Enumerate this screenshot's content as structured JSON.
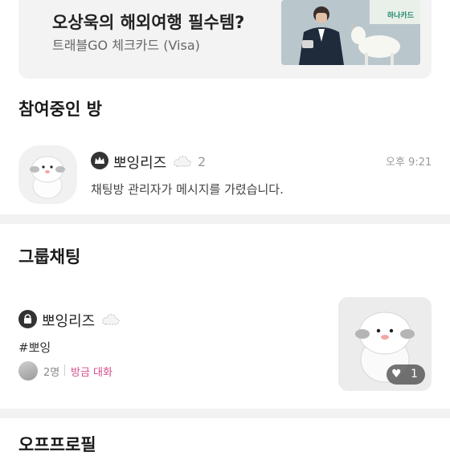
{
  "ad": {
    "title": "오상욱의 해외여행 필수템?",
    "subtitle": "트래블GO 체크카드 (Visa)",
    "brand": "하나카드"
  },
  "joined": {
    "title": "참여중인 방",
    "room": {
      "name": "뽀잉리즈",
      "count": "2",
      "time": "오후 9:21",
      "message": "채팅방 관리자가 메시지를 가렸습니다."
    }
  },
  "group": {
    "title": "그룹채팅",
    "room": {
      "name": "뽀잉리즈",
      "tag": "#뽀잉",
      "members": "2명",
      "activity": "방금 대화",
      "likes": "1"
    }
  },
  "profile": {
    "title": "오프프로필"
  },
  "colors": {
    "accent_pink": "#d54b8f",
    "divider": "#f2f2f2",
    "banner_bg": "#f3f3f3"
  }
}
